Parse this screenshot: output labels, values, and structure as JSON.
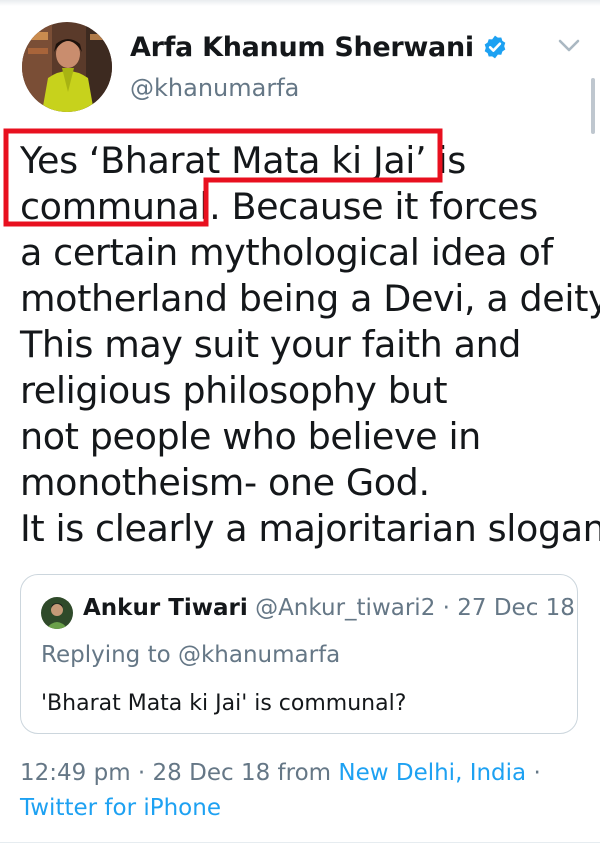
{
  "author": {
    "display_name": "Arfa Khanum Sherwani",
    "handle": "@khanumarfa"
  },
  "tweet": {
    "lines": [
      "Yes ‘Bharat Mata ki Jai’ is",
      "communal. Because it forces",
      "a certain mythological idea of",
      "motherland being a Devi, a deity.",
      "This may suit your faith and",
      "religious philosophy but",
      "not people who believe in",
      "monotheism- one God.",
      "It is clearly a majoritarian slogan."
    ]
  },
  "quoted_tweet": {
    "author_name": "Ankur Tiwari",
    "handle": "@Ankur_tiwari2",
    "separator": "·",
    "date": "27 Dec 18",
    "reply_prefix": "Replying to",
    "reply_handle": "@khanumarfa",
    "text": "'Bharat Mata ki Jai' is communal?"
  },
  "timestamp": {
    "time": "12:49 pm",
    "separator": "·",
    "date": "28 Dec 18",
    "from_label": "from",
    "location": "New Delhi, India",
    "trailing_separator": "·",
    "source": "Twitter for iPhone"
  },
  "icons": {
    "verified": "verified-badge-icon",
    "menu": "chevron-down-icon"
  },
  "colors": {
    "link": "#1da1f2",
    "secondary_text": "#657786",
    "highlight_box": "#e8101f",
    "border": "#ccd6dd"
  }
}
